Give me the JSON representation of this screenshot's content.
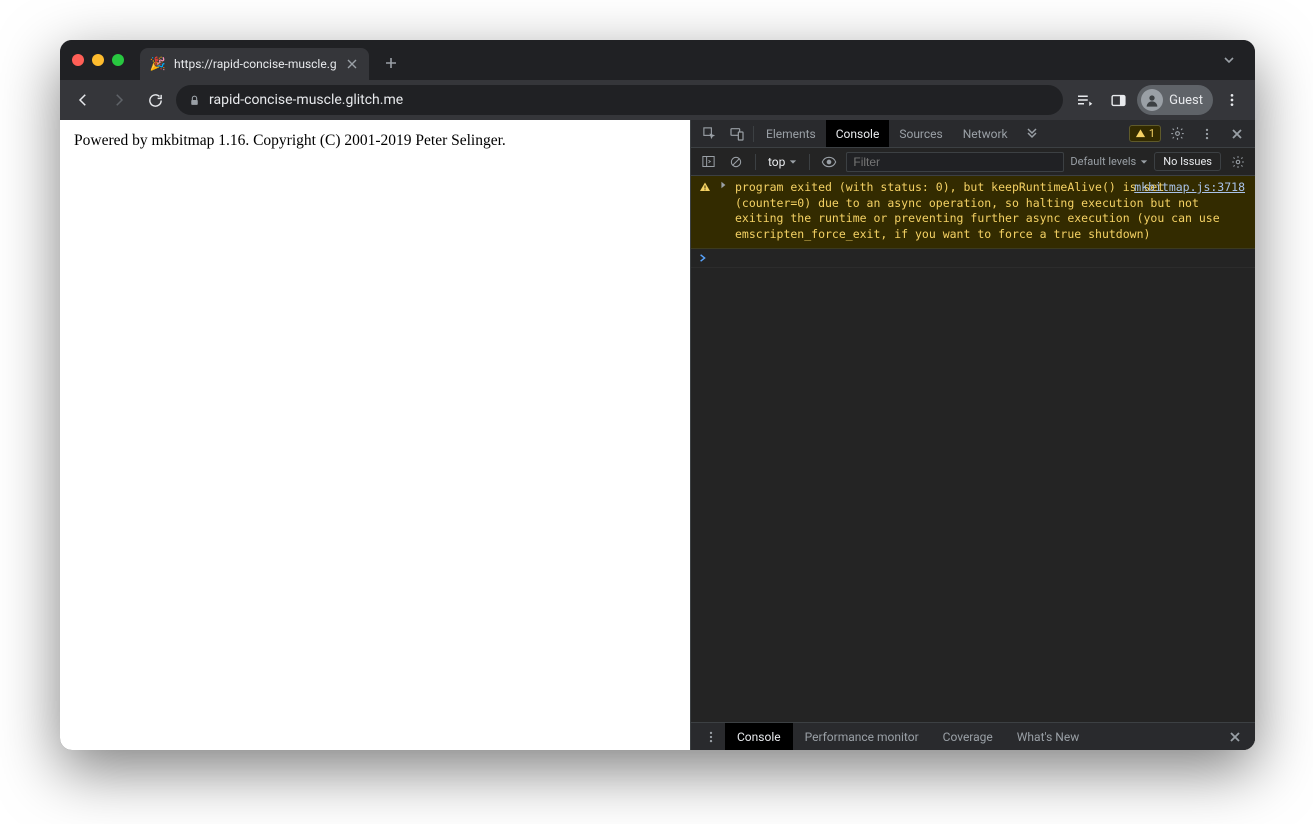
{
  "tab": {
    "title": "https://rapid-concise-muscle.g",
    "favicon": "🎉"
  },
  "toolbar": {
    "url": "rapid-concise-muscle.glitch.me",
    "guest_label": "Guest"
  },
  "page": {
    "text": "Powered by mkbitmap 1.16. Copyright (C) 2001-2019 Peter Selinger."
  },
  "devtools": {
    "tabs": {
      "elements": "Elements",
      "console": "Console",
      "sources": "Sources",
      "network": "Network"
    },
    "warnings_count": "1",
    "console_toolbar": {
      "context": "top",
      "filter_placeholder": "Filter",
      "levels_label": "Default levels",
      "issues_label": "No Issues"
    },
    "messages": [
      {
        "level": "warning",
        "text": "program exited (with status: 0), but keepRuntimeAlive() is set (counter=0) due to an async operation, so halting execution but not exiting the runtime or preventing further async execution (you can use emscripten_force_exit, if you want to force a true shutdown)",
        "source": "mkbitmap.js:3718"
      }
    ],
    "drawer": {
      "console": "Console",
      "perf": "Performance monitor",
      "coverage": "Coverage",
      "whatsnew": "What's New"
    }
  }
}
